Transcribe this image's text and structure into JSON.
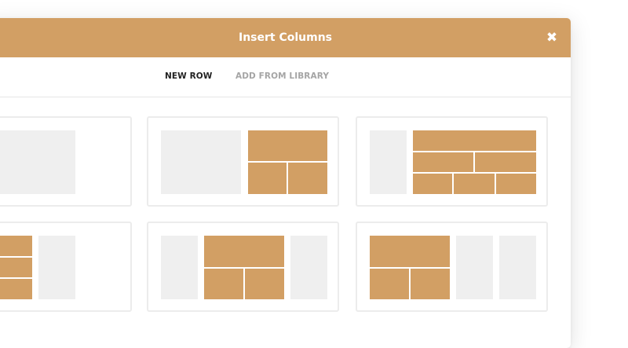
{
  "modal": {
    "title": "Insert Columns",
    "close_icon": "close-icon"
  },
  "tabs": [
    {
      "label": "NEW ROW",
      "active": true
    },
    {
      "label": "ADD FROM LIBRARY",
      "active": false
    }
  ],
  "colors": {
    "accent": "#d29f64",
    "placeholder": "#efefef",
    "card_border": "#ececec"
  },
  "layout_options": [
    {
      "id": "layout-1",
      "description": "two-columns-left-split"
    },
    {
      "id": "layout-2",
      "description": "two-columns-right-split"
    },
    {
      "id": "layout-3",
      "description": "narrow-left-wide-right-nested"
    },
    {
      "id": "layout-4",
      "description": "wide-left-nested-narrow-right"
    },
    {
      "id": "layout-5",
      "description": "three-columns-center-split"
    },
    {
      "id": "layout-6",
      "description": "three-columns-left-split"
    }
  ]
}
